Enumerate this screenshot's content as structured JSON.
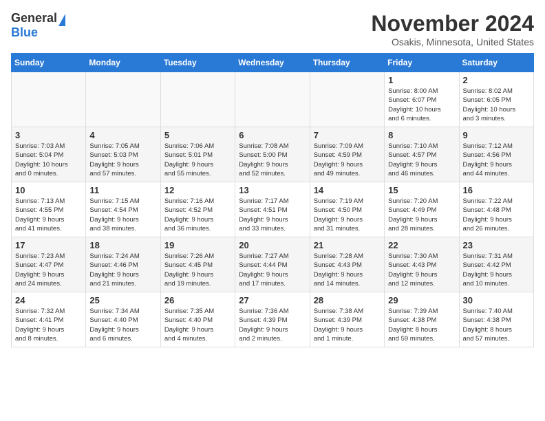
{
  "header": {
    "logo_general": "General",
    "logo_blue": "Blue",
    "month_title": "November 2024",
    "location": "Osakis, Minnesota, United States"
  },
  "calendar": {
    "days_of_week": [
      "Sunday",
      "Monday",
      "Tuesday",
      "Wednesday",
      "Thursday",
      "Friday",
      "Saturday"
    ],
    "weeks": [
      [
        {
          "day": "",
          "info": ""
        },
        {
          "day": "",
          "info": ""
        },
        {
          "day": "",
          "info": ""
        },
        {
          "day": "",
          "info": ""
        },
        {
          "day": "",
          "info": ""
        },
        {
          "day": "1",
          "info": "Sunrise: 8:00 AM\nSunset: 6:07 PM\nDaylight: 10 hours\nand 6 minutes."
        },
        {
          "day": "2",
          "info": "Sunrise: 8:02 AM\nSunset: 6:05 PM\nDaylight: 10 hours\nand 3 minutes."
        }
      ],
      [
        {
          "day": "3",
          "info": "Sunrise: 7:03 AM\nSunset: 5:04 PM\nDaylight: 10 hours\nand 0 minutes."
        },
        {
          "day": "4",
          "info": "Sunrise: 7:05 AM\nSunset: 5:03 PM\nDaylight: 9 hours\nand 57 minutes."
        },
        {
          "day": "5",
          "info": "Sunrise: 7:06 AM\nSunset: 5:01 PM\nDaylight: 9 hours\nand 55 minutes."
        },
        {
          "day": "6",
          "info": "Sunrise: 7:08 AM\nSunset: 5:00 PM\nDaylight: 9 hours\nand 52 minutes."
        },
        {
          "day": "7",
          "info": "Sunrise: 7:09 AM\nSunset: 4:59 PM\nDaylight: 9 hours\nand 49 minutes."
        },
        {
          "day": "8",
          "info": "Sunrise: 7:10 AM\nSunset: 4:57 PM\nDaylight: 9 hours\nand 46 minutes."
        },
        {
          "day": "9",
          "info": "Sunrise: 7:12 AM\nSunset: 4:56 PM\nDaylight: 9 hours\nand 44 minutes."
        }
      ],
      [
        {
          "day": "10",
          "info": "Sunrise: 7:13 AM\nSunset: 4:55 PM\nDaylight: 9 hours\nand 41 minutes."
        },
        {
          "day": "11",
          "info": "Sunrise: 7:15 AM\nSunset: 4:54 PM\nDaylight: 9 hours\nand 38 minutes."
        },
        {
          "day": "12",
          "info": "Sunrise: 7:16 AM\nSunset: 4:52 PM\nDaylight: 9 hours\nand 36 minutes."
        },
        {
          "day": "13",
          "info": "Sunrise: 7:17 AM\nSunset: 4:51 PM\nDaylight: 9 hours\nand 33 minutes."
        },
        {
          "day": "14",
          "info": "Sunrise: 7:19 AM\nSunset: 4:50 PM\nDaylight: 9 hours\nand 31 minutes."
        },
        {
          "day": "15",
          "info": "Sunrise: 7:20 AM\nSunset: 4:49 PM\nDaylight: 9 hours\nand 28 minutes."
        },
        {
          "day": "16",
          "info": "Sunrise: 7:22 AM\nSunset: 4:48 PM\nDaylight: 9 hours\nand 26 minutes."
        }
      ],
      [
        {
          "day": "17",
          "info": "Sunrise: 7:23 AM\nSunset: 4:47 PM\nDaylight: 9 hours\nand 24 minutes."
        },
        {
          "day": "18",
          "info": "Sunrise: 7:24 AM\nSunset: 4:46 PM\nDaylight: 9 hours\nand 21 minutes."
        },
        {
          "day": "19",
          "info": "Sunrise: 7:26 AM\nSunset: 4:45 PM\nDaylight: 9 hours\nand 19 minutes."
        },
        {
          "day": "20",
          "info": "Sunrise: 7:27 AM\nSunset: 4:44 PM\nDaylight: 9 hours\nand 17 minutes."
        },
        {
          "day": "21",
          "info": "Sunrise: 7:28 AM\nSunset: 4:43 PM\nDaylight: 9 hours\nand 14 minutes."
        },
        {
          "day": "22",
          "info": "Sunrise: 7:30 AM\nSunset: 4:43 PM\nDaylight: 9 hours\nand 12 minutes."
        },
        {
          "day": "23",
          "info": "Sunrise: 7:31 AM\nSunset: 4:42 PM\nDaylight: 9 hours\nand 10 minutes."
        }
      ],
      [
        {
          "day": "24",
          "info": "Sunrise: 7:32 AM\nSunset: 4:41 PM\nDaylight: 9 hours\nand 8 minutes."
        },
        {
          "day": "25",
          "info": "Sunrise: 7:34 AM\nSunset: 4:40 PM\nDaylight: 9 hours\nand 6 minutes."
        },
        {
          "day": "26",
          "info": "Sunrise: 7:35 AM\nSunset: 4:40 PM\nDaylight: 9 hours\nand 4 minutes."
        },
        {
          "day": "27",
          "info": "Sunrise: 7:36 AM\nSunset: 4:39 PM\nDaylight: 9 hours\nand 2 minutes."
        },
        {
          "day": "28",
          "info": "Sunrise: 7:38 AM\nSunset: 4:39 PM\nDaylight: 9 hours\nand 1 minute."
        },
        {
          "day": "29",
          "info": "Sunrise: 7:39 AM\nSunset: 4:38 PM\nDaylight: 8 hours\nand 59 minutes."
        },
        {
          "day": "30",
          "info": "Sunrise: 7:40 AM\nSunset: 4:38 PM\nDaylight: 8 hours\nand 57 minutes."
        }
      ]
    ]
  }
}
